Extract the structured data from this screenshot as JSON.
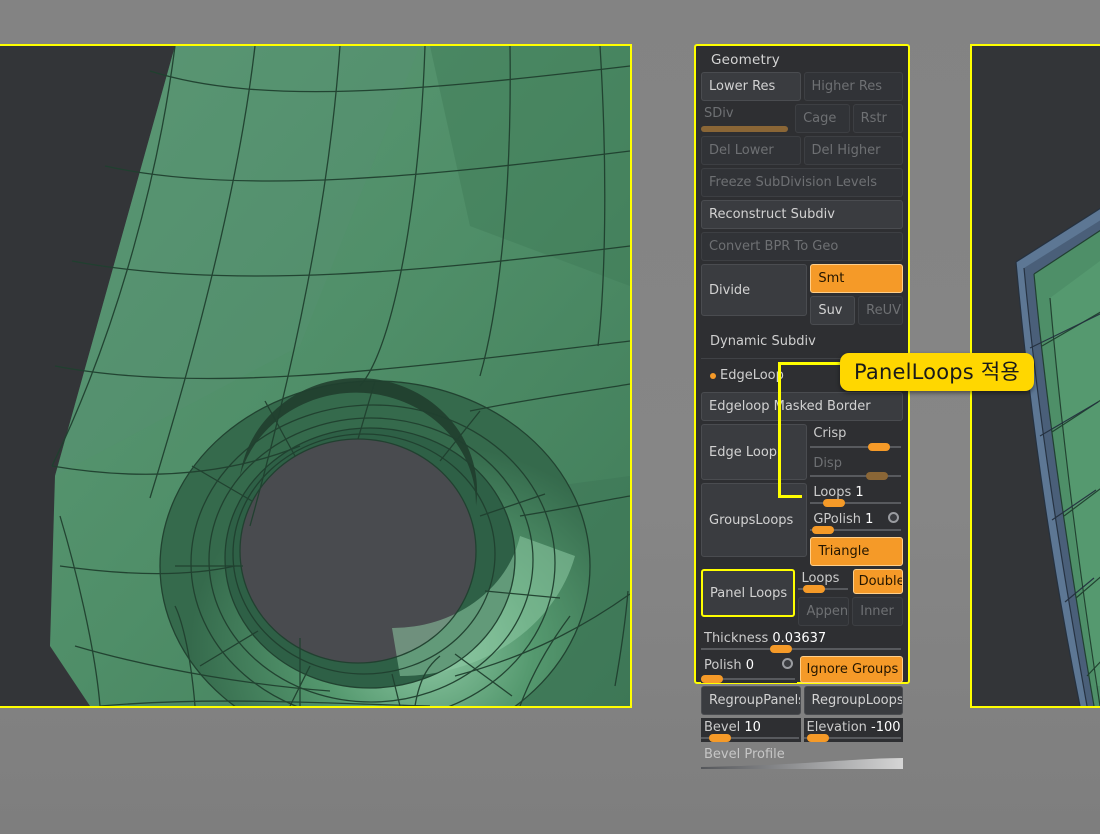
{
  "app": {
    "background_color": "#808080",
    "accent": "#f59a28",
    "highlight": "#ffff00"
  },
  "viewports": {
    "left": {
      "name": "left-viewport",
      "bg": "#333538",
      "mesh_color": "#4e8f68",
      "border": "#ffff00"
    },
    "right": {
      "name": "right-viewport",
      "bg": "#333538",
      "mesh_color": "#4e8f68",
      "bevel_color": "#6d88a8",
      "border": "#ffff00"
    }
  },
  "palette": {
    "title": "Geometry",
    "rows": {
      "lower_res": "Lower Res",
      "higher_res": "Higher Res",
      "sdiv": "SDiv",
      "cage": "Cage",
      "rstr": "Rstr",
      "del_lower": "Del Lower",
      "del_higher": "Del Higher",
      "freeze": "Freeze SubDivision Levels",
      "reconstruct": "Reconstruct Subdiv",
      "convert_bpr": "Convert BPR To Geo",
      "divide": "Divide",
      "smt": "Smt",
      "suv": "Suv",
      "reuv": "ReUV",
      "dynamic_subdiv": "Dynamic Subdiv",
      "edgeloop_header": "EdgeLoop",
      "edgeloop_masked_border": "Edgeloop Masked Border",
      "edge_loop": "Edge Loop",
      "crisp": "Crisp",
      "disp": "Disp",
      "groups_loops": "GroupsLoops",
      "loops_gl_label": "Loops",
      "loops_gl_value": "1",
      "gpolish_label": "GPolish",
      "gpolish_value": "1",
      "triangle": "Triangle",
      "panel_loops": "Panel Loops",
      "loops_label": "Loops",
      "double": "Double",
      "append": "Append",
      "inner": "Inner",
      "thickness_label": "Thickness",
      "thickness_value": "0.03637",
      "polish_label": "Polish",
      "polish_value": "0",
      "ignore_groups": "Ignore Groups",
      "regroup_panels": "RegroupPanels",
      "regroup_loops": "RegroupLoops",
      "bevel_label": "Bevel",
      "bevel_value": "10",
      "elevation_label": "Elevation",
      "elevation_value": "-100",
      "bevel_profile": "Bevel Profile"
    }
  },
  "callout": {
    "text": "PanelLoops 적용",
    "bg": "#ffd700"
  }
}
